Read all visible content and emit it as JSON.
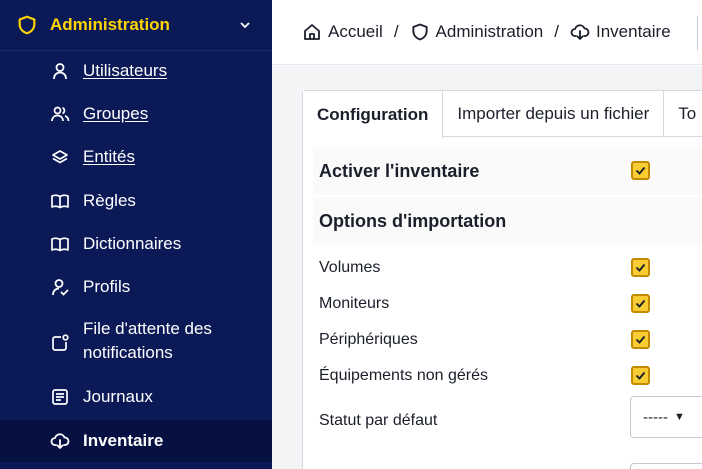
{
  "sidebar": {
    "header": {
      "label": "Administration",
      "icon": "shield-icon",
      "chevron": "chevron-down-icon"
    },
    "items": [
      {
        "label": "Utilisateurs",
        "icon": "user-icon"
      },
      {
        "label": "Groupes",
        "icon": "users-icon"
      },
      {
        "label": "Entités",
        "icon": "layers-icon"
      },
      {
        "label": "Règles",
        "icon": "book-icon"
      },
      {
        "label": "Dictionnaires",
        "icon": "book-icon"
      },
      {
        "label": "Profils",
        "icon": "user-check-icon"
      },
      {
        "label": "File d'attente des",
        "label2": "notifications",
        "icon": "notification-icon"
      },
      {
        "label": "Journaux",
        "icon": "news-icon"
      },
      {
        "label": "Inventaire",
        "icon": "cloud-download-icon",
        "active": true
      }
    ]
  },
  "breadcrumb": {
    "items": [
      {
        "label": "Accueil",
        "icon": "home-icon"
      },
      {
        "label": "Administration",
        "icon": "shield-icon"
      },
      {
        "label": "Inventaire",
        "icon": "cloud-download-icon"
      }
    ],
    "separator": "/"
  },
  "tabs": [
    {
      "label": "Configuration",
      "active": true
    },
    {
      "label": "Importer depuis un fichier"
    },
    {
      "label": "To"
    }
  ],
  "form": {
    "enable": {
      "label": "Activer l'inventaire",
      "checked": true
    },
    "import_section": "Options d'importation",
    "options": [
      {
        "label": "Volumes",
        "checked": true
      },
      {
        "label": "Moniteurs",
        "checked": true
      },
      {
        "label": "Périphériques",
        "checked": true
      },
      {
        "label": "Équipements non gérés",
        "checked": true
      }
    ],
    "default_status": {
      "label": "Statut par défaut",
      "value": "-----"
    }
  },
  "colors": {
    "sidebar_bg": "#0b1a57",
    "accent": "#ffd400",
    "checkbox": "#f8cd33"
  }
}
